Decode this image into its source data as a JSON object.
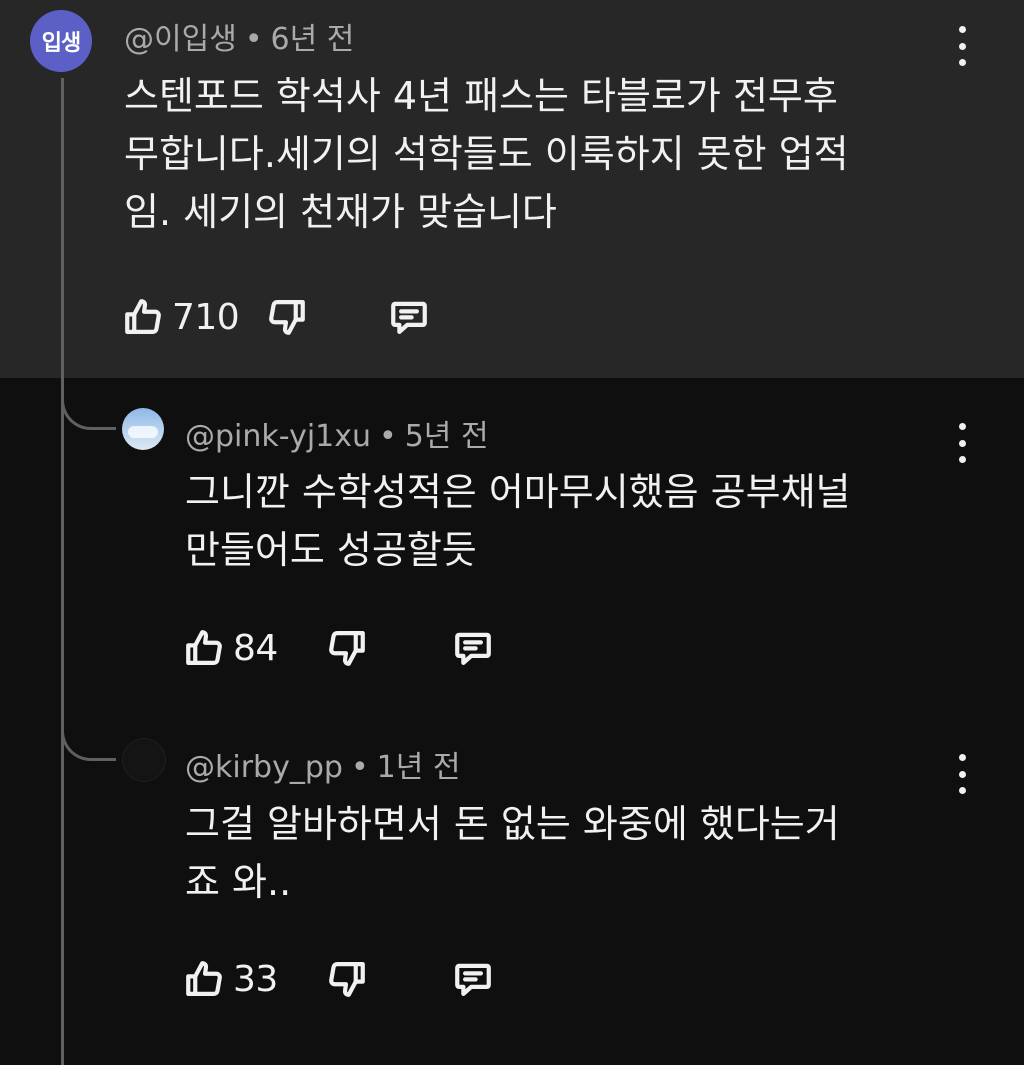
{
  "comments": [
    {
      "avatar_text": "입생",
      "author": "@이입생",
      "time": "6년 전",
      "lines": [
        "스텐포드 학석사 4년 패스는 타블로가 전무후",
        "무합니다.세기의 석학들도 이룩하지 못한 업적",
        "임.  세기의 천재가 맞습니다"
      ],
      "likes": "710",
      "icons": {
        "like": "thumbs-up-icon",
        "dislike": "thumbs-down-icon",
        "reply": "comment-icon",
        "more": "more-vertical-icon"
      }
    },
    {
      "author": "@pink-yj1xu",
      "time": "5년 전",
      "lines": [
        "그니깐 수학성적은 어마무시했음 공부채널",
        "만들어도 성공할듯"
      ],
      "likes": "84"
    },
    {
      "author": "@kirby_pp",
      "time": "1년 전",
      "lines": [
        "그걸 알바하면서 돈 없는 와중에 했다는거",
        "죠 와.."
      ],
      "likes": "33"
    }
  ],
  "colors": {
    "top_background": "#272727",
    "page_background": "#0f0f0f",
    "avatar_background": "#5c5fc6",
    "meta_text": "#aaaaaa",
    "body_text": "#f1f1f1"
  },
  "separator": "•"
}
